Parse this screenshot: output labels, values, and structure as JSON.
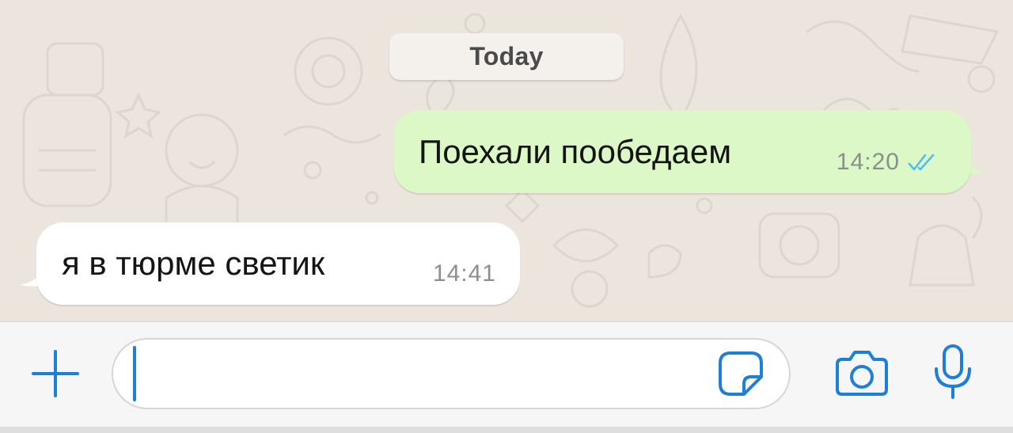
{
  "chat": {
    "date_separator": "Today",
    "messages": [
      {
        "direction": "outgoing",
        "text": "Поехали пообедаем",
        "time": "14:20",
        "status": "read",
        "status_icon": "double-check-icon"
      },
      {
        "direction": "incoming",
        "text": "я в тюрме светик",
        "time": "14:41"
      }
    ]
  },
  "composer": {
    "input_value": "",
    "icons": [
      "plus-icon",
      "sticker-icon",
      "camera-icon",
      "microphone-icon"
    ]
  },
  "colors": {
    "accent": "#1e7fd6",
    "outgoing_bubble": "#dcf8c6",
    "incoming_bubble": "#ffffff",
    "read_ticks": "#53bdeb",
    "chat_background": "#ece5dd"
  }
}
